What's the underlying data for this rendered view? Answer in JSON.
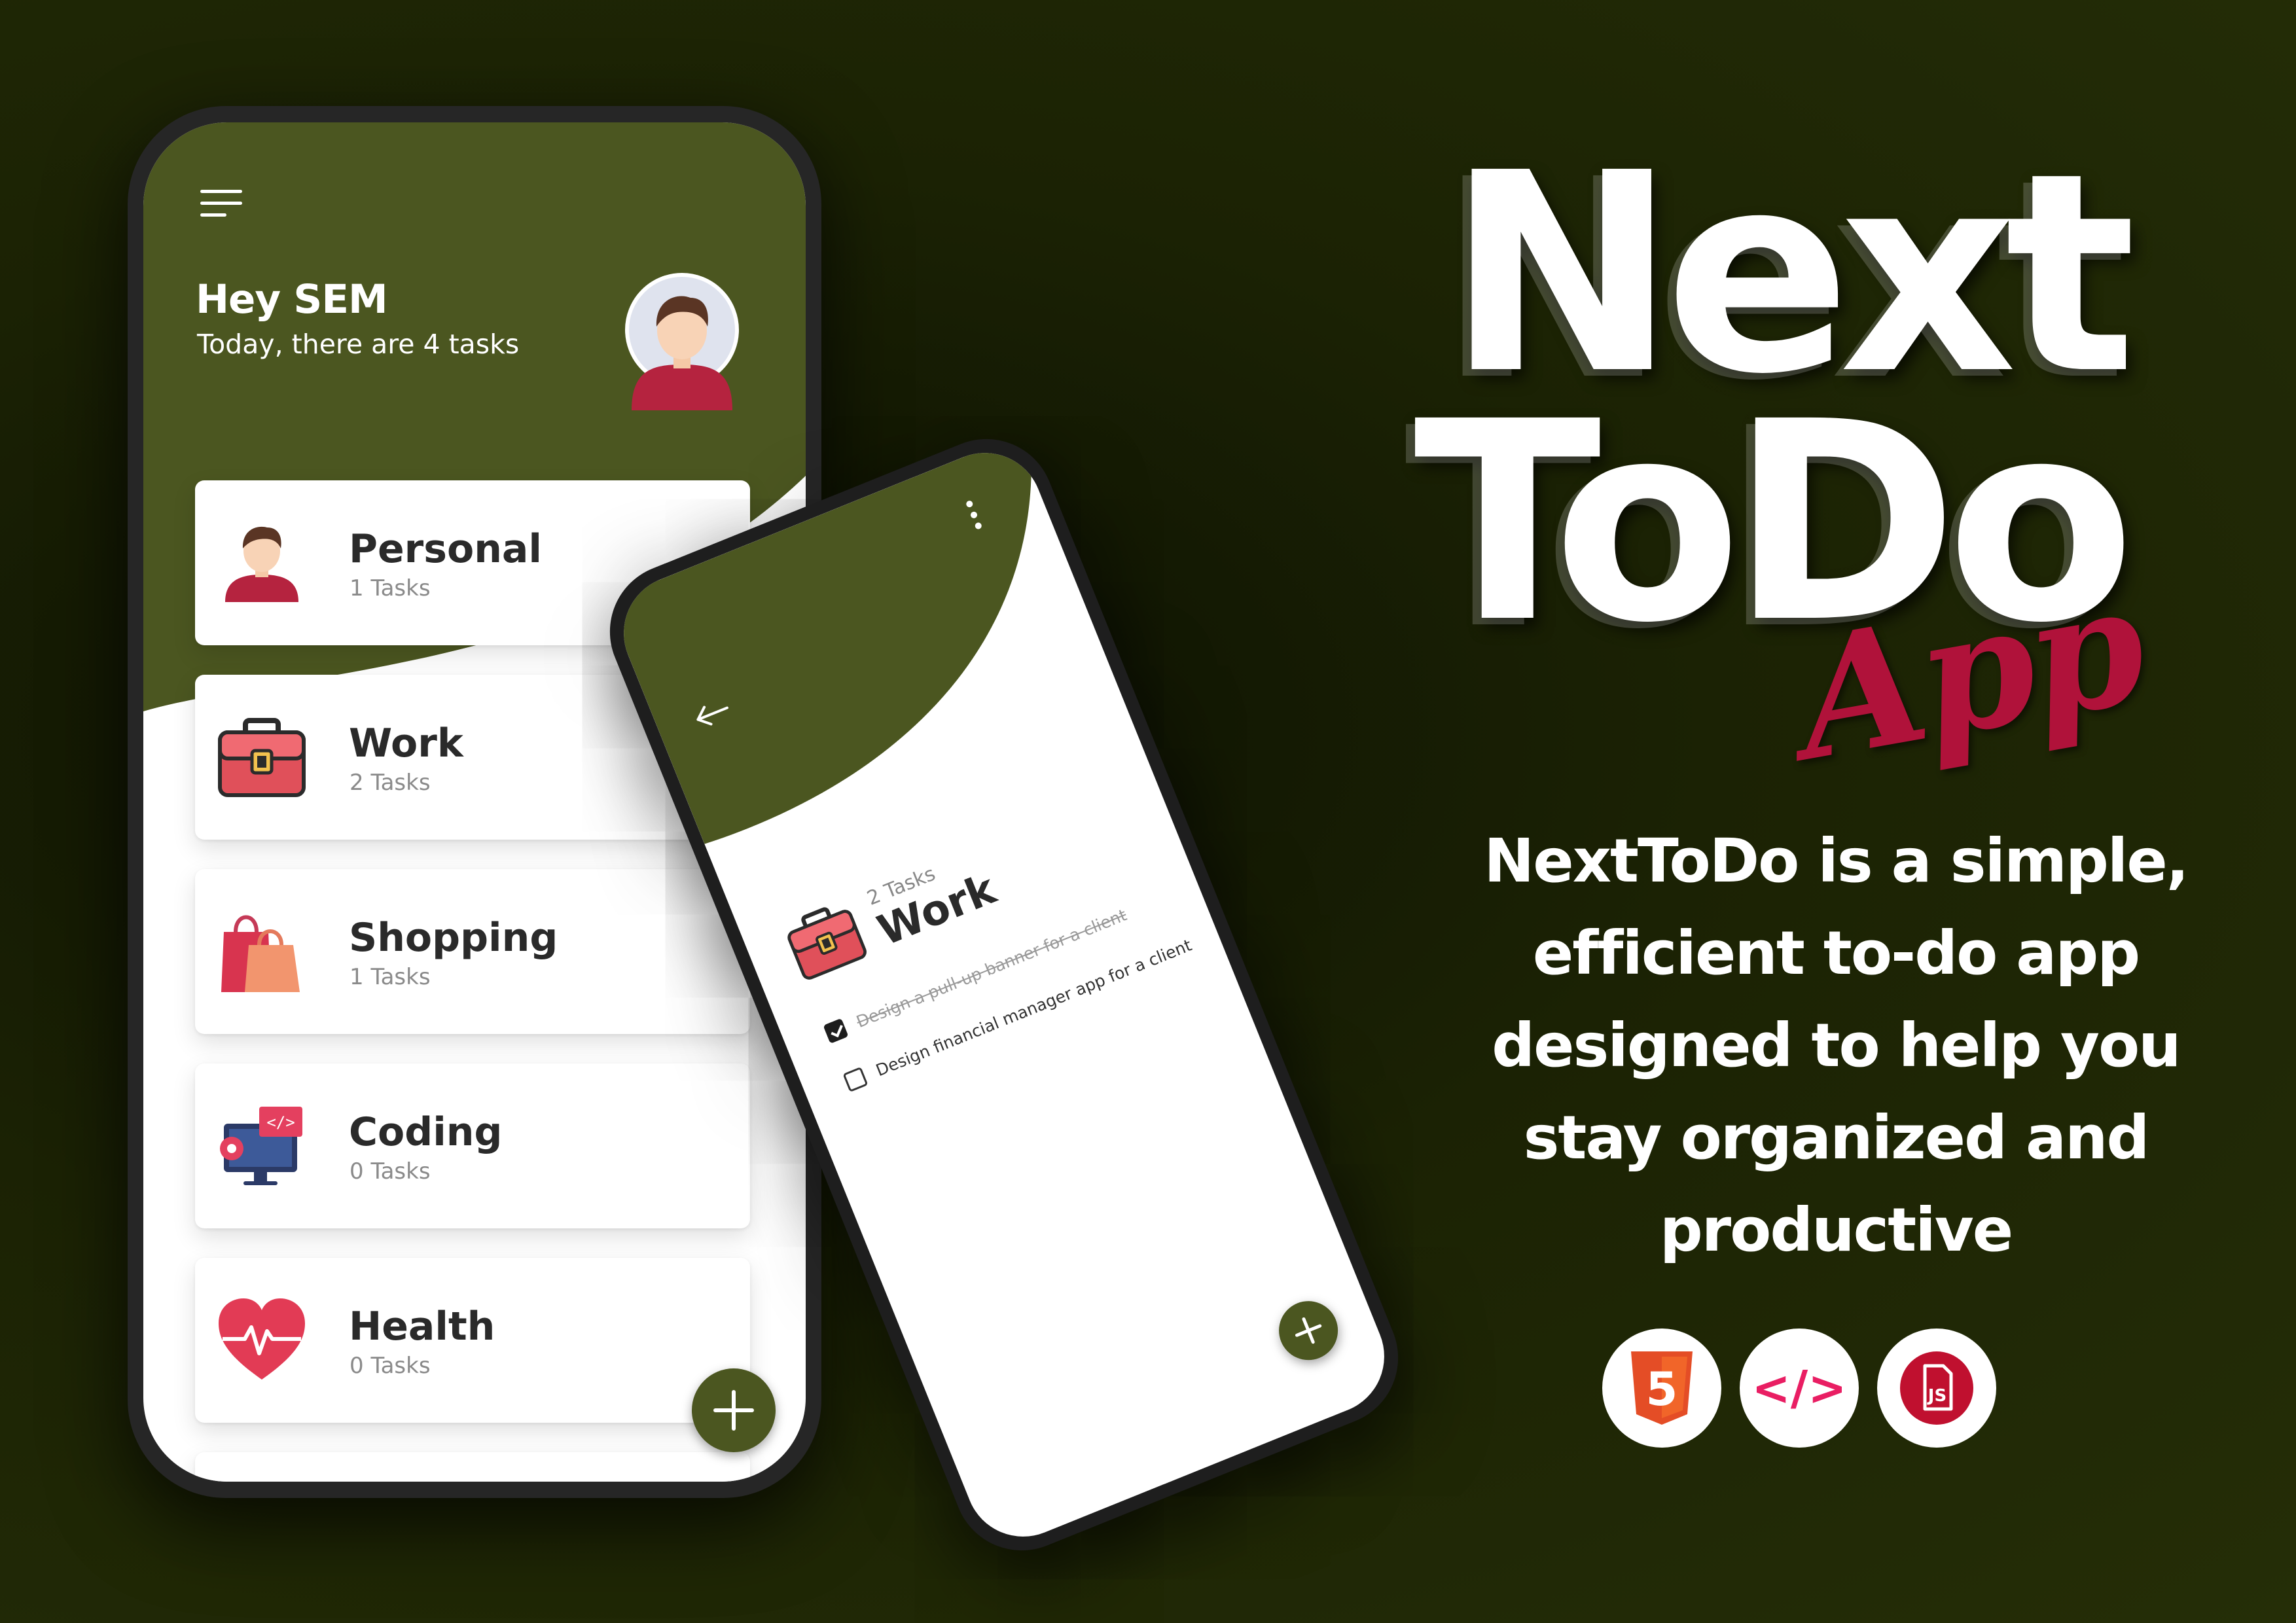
{
  "colors": {
    "background": "#232b06",
    "header_green": "#4b5620",
    "accent_red": "#b0123a",
    "card_bg": "#ffffff"
  },
  "phone_home": {
    "greeting": "Hey SEM",
    "subtitle": "Today, there are 4 tasks",
    "menu_icon": "hamburger-menu-icon",
    "avatar_icon": "user-avatar-icon",
    "categories": [
      {
        "name": "Personal",
        "count": "1 Tasks",
        "icon": "person-icon"
      },
      {
        "name": "Work",
        "count": "2 Tasks",
        "icon": "briefcase-icon"
      },
      {
        "name": "Shopping",
        "count": "1 Tasks",
        "icon": "shopping-bags-icon"
      },
      {
        "name": "Coding",
        "count": "0 Tasks",
        "icon": "code-monitor-icon"
      },
      {
        "name": "Health",
        "count": "0 Tasks",
        "icon": "heart-pulse-icon"
      }
    ],
    "fab_icon": "plus-icon"
  },
  "phone_detail": {
    "back_icon": "back-arrow-icon",
    "more_icon": "more-vertical-icon",
    "category_count": "2 Tasks",
    "category_name": "Work",
    "tasks": [
      {
        "text": "Design a pull-up banner for a client",
        "done": true
      },
      {
        "text": "Design financial manager app for a client",
        "done": false
      }
    ],
    "fab_icon": "plus-icon"
  },
  "promo": {
    "title_line1": "Next",
    "title_line2": "ToDo",
    "title_app": "App",
    "description_lines": [
      "NextToDo is a simple,",
      "efficient to-do app",
      "designed to help you",
      "stay organized and",
      "productive"
    ],
    "tech_badges": [
      {
        "icon": "html5-icon",
        "label": "5"
      },
      {
        "icon": "code-icon",
        "label": "</>"
      },
      {
        "icon": "javascript-icon",
        "label": "JS"
      }
    ]
  }
}
